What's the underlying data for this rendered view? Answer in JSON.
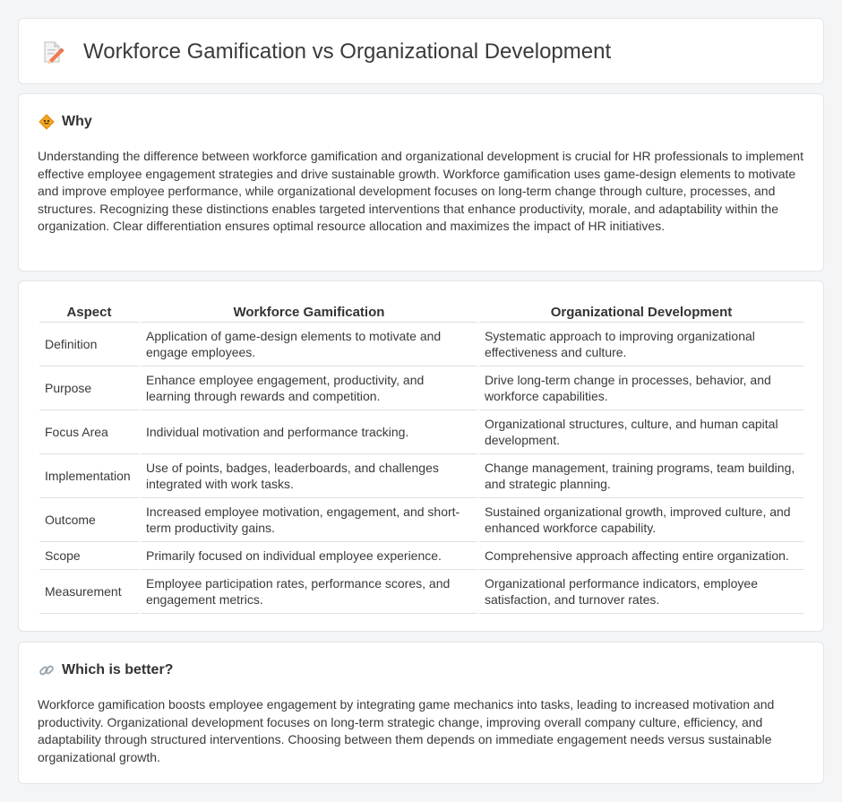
{
  "title": "Workforce Gamification vs Organizational Development",
  "why": {
    "heading": "Why",
    "text": "Understanding the difference between workforce gamification and organizational development is crucial for HR professionals to implement effective employee engagement strategies and drive sustainable growth. Workforce gamification uses game-design elements to motivate and improve employee performance, while organizational development focuses on long-term change through culture, processes, and structures. Recognizing these distinctions enables targeted interventions that enhance productivity, morale, and adaptability within the organization. Clear differentiation ensures optimal resource allocation and maximizes the impact of HR initiatives."
  },
  "table": {
    "headers": [
      "Aspect",
      "Workforce Gamification",
      "Organizational Development"
    ],
    "rows": [
      {
        "aspect": "Definition",
        "wg": "Application of game-design elements to motivate and engage employees.",
        "od": "Systematic approach to improving organizational effectiveness and culture."
      },
      {
        "aspect": "Purpose",
        "wg": "Enhance employee engagement, productivity, and learning through rewards and competition.",
        "od": "Drive long-term change in processes, behavior, and workforce capabilities."
      },
      {
        "aspect": "Focus Area",
        "wg": "Individual motivation and performance tracking.",
        "od": "Organizational structures, culture, and human capital development."
      },
      {
        "aspect": "Implementation",
        "wg": "Use of points, badges, leaderboards, and challenges integrated with work tasks.",
        "od": "Change management, training programs, team building, and strategic planning."
      },
      {
        "aspect": "Outcome",
        "wg": "Increased employee motivation, engagement, and short-term productivity gains.",
        "od": "Sustained organizational growth, improved culture, and enhanced workforce capability."
      },
      {
        "aspect": "Scope",
        "wg": "Primarily focused on individual employee experience.",
        "od": "Comprehensive approach affecting entire organization."
      },
      {
        "aspect": "Measurement",
        "wg": "Employee participation rates, performance scores, and engagement metrics.",
        "od": "Organizational performance indicators, employee satisfaction, and turnover rates."
      }
    ]
  },
  "better": {
    "heading": "Which is better?",
    "text": "Workforce gamification boosts employee engagement by integrating game mechanics into tasks, leading to increased motivation and productivity. Organizational development focuses on long-term strategic change, improving overall company culture, efficiency, and adaptability through structured interventions. Choosing between them depends on immediate engagement needs versus sustainable organizational growth."
  },
  "icons": {
    "title": "document-pencil-icon",
    "why": "diamond-sign-icon",
    "better": "link-icon"
  }
}
